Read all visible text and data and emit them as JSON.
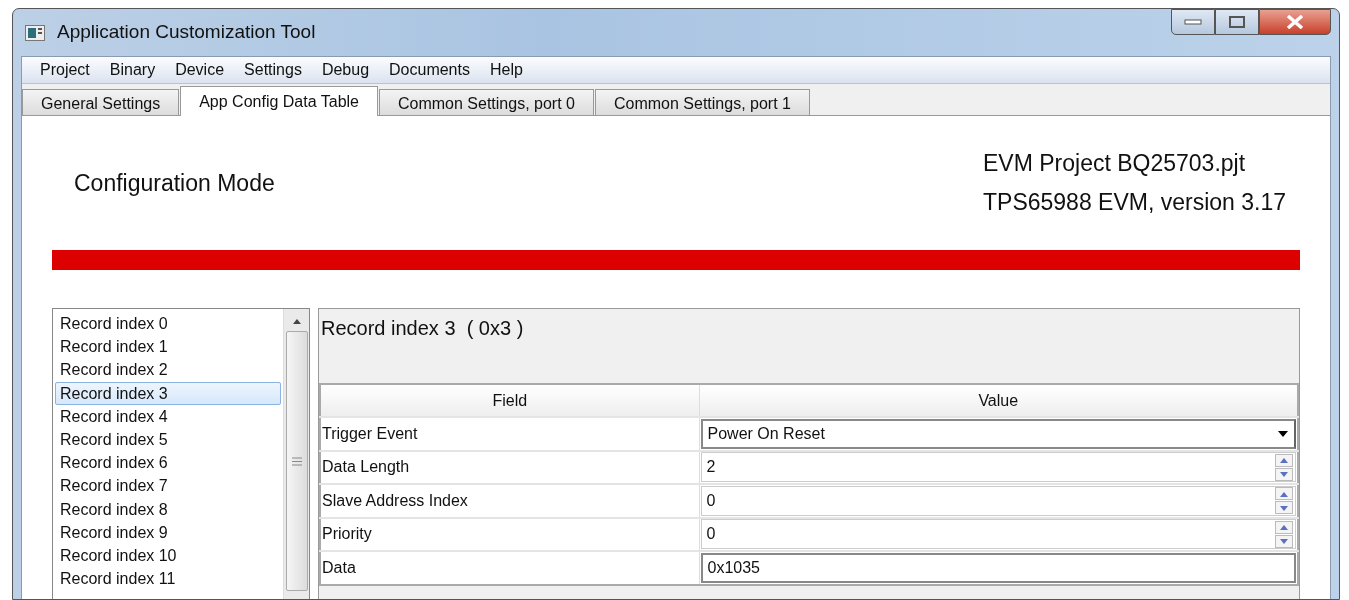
{
  "window": {
    "title": "Application Customization Tool"
  },
  "menu": [
    "Project",
    "Binary",
    "Device",
    "Settings",
    "Debug",
    "Documents",
    "Help"
  ],
  "tabs": [
    {
      "label": "General Settings",
      "selected": false
    },
    {
      "label": "App Config Data Table",
      "selected": true
    },
    {
      "label": "Common Settings, port 0",
      "selected": false
    },
    {
      "label": "Common Settings, port 1",
      "selected": false
    }
  ],
  "mode": "Configuration Mode",
  "project_info": [
    "EVM Project BQ25703.pjt",
    "TPS65988 EVM, version 3.17"
  ],
  "mode_bar": {
    "color": "#dd0000"
  },
  "records": [
    {
      "label": "Record index 0",
      "selected": false
    },
    {
      "label": "Record index 1",
      "selected": false
    },
    {
      "label": "Record index 2",
      "selected": false
    },
    {
      "label": "Record index 3",
      "selected": true
    },
    {
      "label": "Record index 4",
      "selected": false
    },
    {
      "label": "Record index 5",
      "selected": false
    },
    {
      "label": "Record index 6",
      "selected": false
    },
    {
      "label": "Record index 7",
      "selected": false
    },
    {
      "label": "Record index 8",
      "selected": false
    },
    {
      "label": "Record index 9",
      "selected": false
    },
    {
      "label": "Record index 10",
      "selected": false
    },
    {
      "label": "Record index 11",
      "selected": false
    }
  ],
  "detail": {
    "title": "Record index 3  ( 0x3 )",
    "table": {
      "columns": [
        "Field",
        "Value"
      ],
      "rows": [
        {
          "field": "Trigger Event",
          "value": "Power On Reset",
          "kind": "dropdown"
        },
        {
          "field": "Data Length",
          "value": "2",
          "kind": "spinner"
        },
        {
          "field": "Slave Address Index",
          "value": "0",
          "kind": "spinner"
        },
        {
          "field": "Priority",
          "value": "0",
          "kind": "spinner"
        },
        {
          "field": "Data",
          "value": "0x1035",
          "kind": "text"
        }
      ]
    }
  }
}
